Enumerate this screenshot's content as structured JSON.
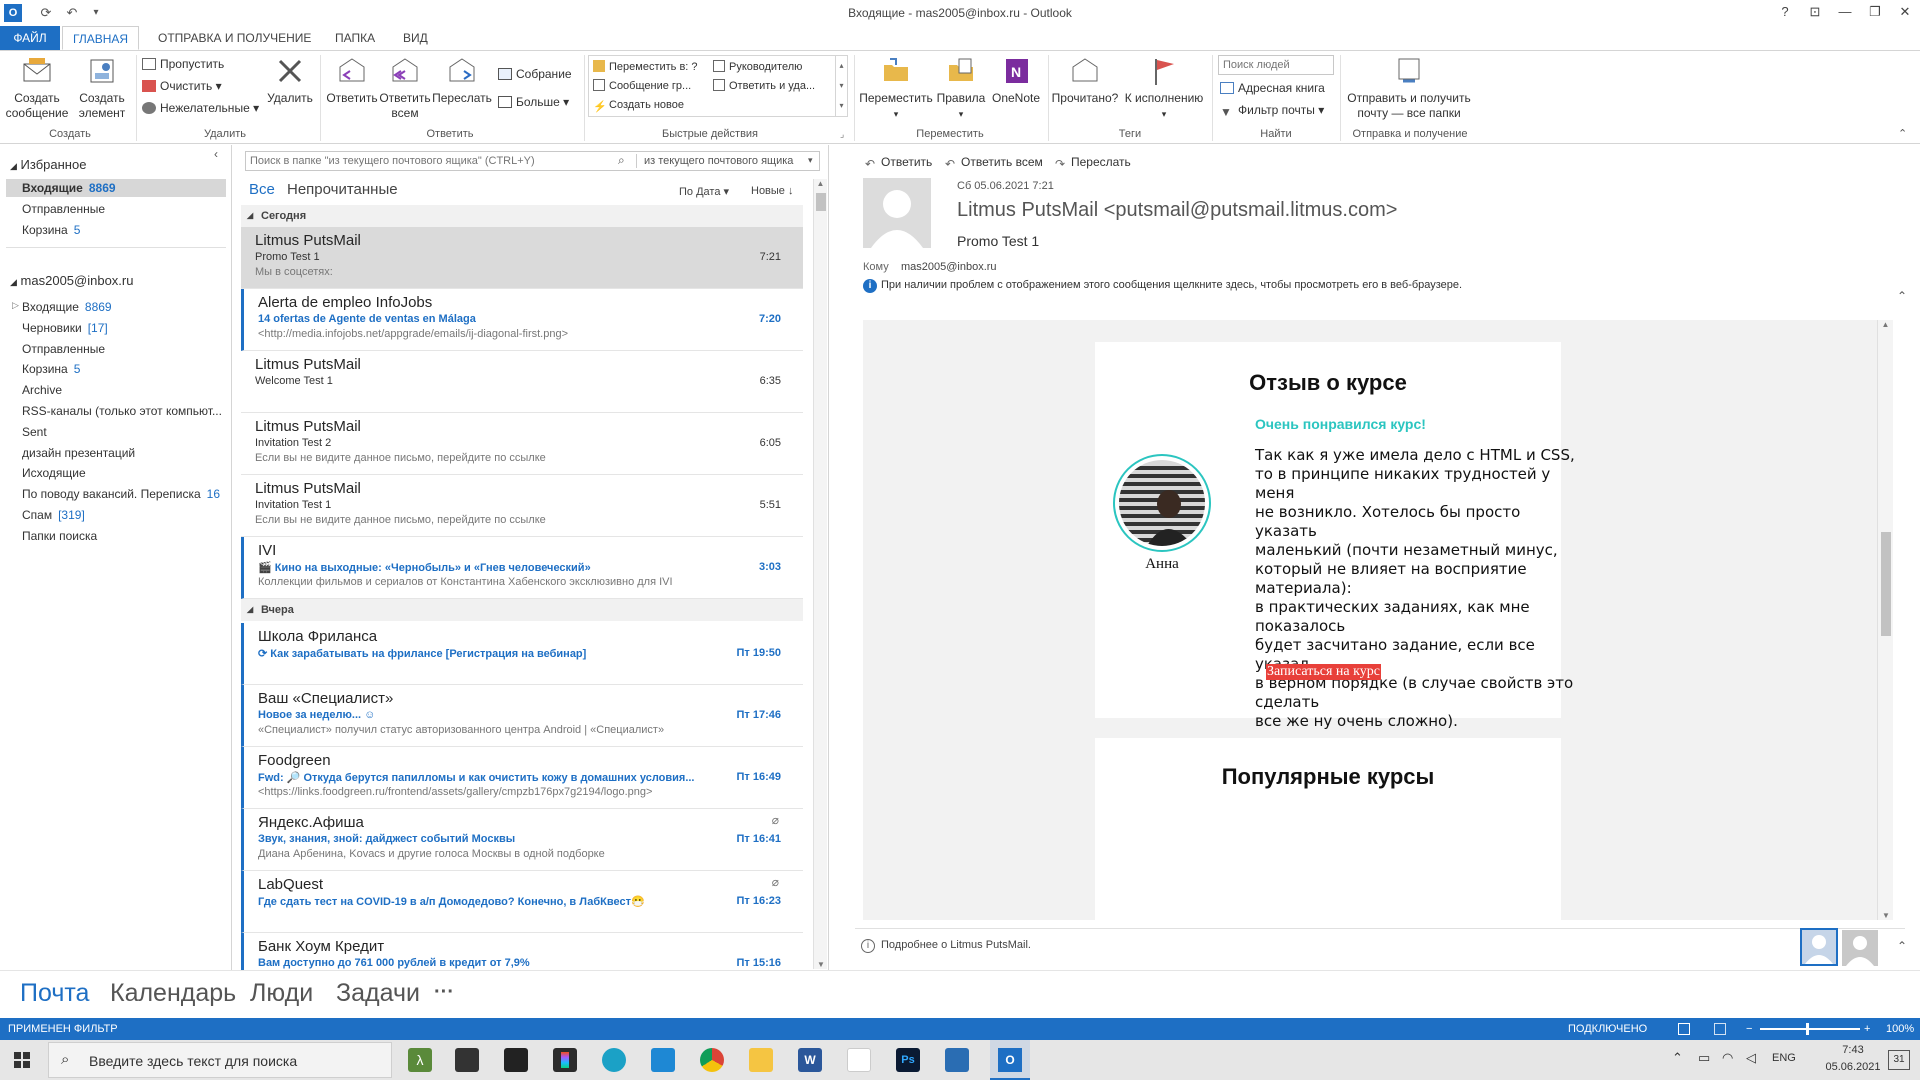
{
  "window": {
    "title": "Входящие - mas2005@inbox.ru - Outlook"
  },
  "titlebar": {
    "help": "?",
    "restore_ribbon": "⊡",
    "minimize": "—",
    "maximize": "❐",
    "close": "✕"
  },
  "tabs": [
    "ФАЙЛ",
    "ГЛАВНАЯ",
    "ОТПРАВКА И ПОЛУЧЕНИЕ",
    "ПАПКА",
    "ВИД"
  ],
  "ribbon": {
    "create": {
      "new_message": "Создать\nсообщение",
      "new_item": "Создать\nэлемент",
      "label": "Создать"
    },
    "delete": {
      "ignore": "Пропустить",
      "clean": "Очистить",
      "junk": "Нежелательные",
      "delete": "Удалить",
      "label": "Удалить"
    },
    "respond": {
      "reply": "Ответить",
      "reply_all": "Ответить\nвсем",
      "forward": "Переслать",
      "meeting": "Собрание",
      "more": "Больше",
      "label": "Ответить"
    },
    "quick_steps": {
      "move_to": "Переместить в: ?",
      "team_email": "Сообщение гр...",
      "create_new": "Создать новое",
      "to_manager": "Руководителю",
      "reply_delete": "Ответить и уда...",
      "label": "Быстрые действия"
    },
    "move": {
      "move": "Переместить",
      "rules": "Правила",
      "onenote": "OneNote",
      "label": "Переместить"
    },
    "tags": {
      "read": "Прочитано?",
      "followup": "К исполнению",
      "label": "Теги"
    },
    "find": {
      "search_people_placeholder": "Поиск людей",
      "address_book": "Адресная книга",
      "filter_email": "Фильтр почты",
      "label": "Найти"
    },
    "send_receive": {
      "send_all": "Отправить и получить\nпочту — все папки",
      "label": "Отправка и получение"
    }
  },
  "leftnav": {
    "favorites": "Избранное",
    "fav_items": [
      {
        "label": "Входящие",
        "count": "8869"
      },
      {
        "label": "Отправленные",
        "count": ""
      },
      {
        "label": "Корзина",
        "count": "5"
      }
    ],
    "account": "mas2005@inbox.ru",
    "folders": [
      {
        "label": "Входящие",
        "count": "8869"
      },
      {
        "label": "Черновики",
        "count": "[17]"
      },
      {
        "label": "Отправленные",
        "count": ""
      },
      {
        "label": "Корзина",
        "count": "5"
      },
      {
        "label": "Archive",
        "count": ""
      },
      {
        "label": "RSS-каналы (только этот компьют...",
        "count": ""
      },
      {
        "label": "Sent",
        "count": ""
      },
      {
        "label": "дизайн презентаций",
        "count": ""
      },
      {
        "label": "Исходящие",
        "count": ""
      },
      {
        "label": "По поводу вакансий. Переписка",
        "count": "16"
      },
      {
        "label": "Спам",
        "count": "[319]"
      },
      {
        "label": "Папки поиска",
        "count": ""
      }
    ]
  },
  "search": {
    "placeholder": "Поиск в папке \"из текущего почтового ящика\" (CTRL+Y)",
    "scope": "из текущего почтового ящика"
  },
  "list_filters": {
    "all": "Все",
    "unread": "Непрочитанные",
    "by_date": "По Дата",
    "newest": "Новые"
  },
  "groups": {
    "today": "Сегодня",
    "yesterday": "Вчера"
  },
  "messages": [
    {
      "from": "Litmus PutsMail",
      "subject": "Promo Test 1",
      "preview": "Мы в соцсетях:",
      "time": "7:21",
      "unread": false
    },
    {
      "from": "Alerta de empleo InfoJobs",
      "subject": "14 ofertas de Agente de ventas en Málaga",
      "preview": "<http://media.infojobs.net/appgrade/emails/ij-diagonal-first.png>",
      "time": "7:20",
      "unread": true
    },
    {
      "from": "Litmus PutsMail",
      "subject": "Welcome Test 1",
      "preview": "",
      "time": "6:35",
      "unread": false
    },
    {
      "from": "Litmus PutsMail",
      "subject": "Invitation Test 2",
      "preview": "Если вы не видите данное письмо, перейдите по ссылке",
      "time": "6:05",
      "unread": false
    },
    {
      "from": "Litmus PutsMail",
      "subject": "Invitation Test 1",
      "preview": "Если вы не видите данное письмо, перейдите по ссылке",
      "time": "5:51",
      "unread": false
    },
    {
      "from": "IVI",
      "subject": "🎬 Кино на выходные: «Чернобыль» и «Гнев человеческий»",
      "preview": "Коллекции фильмов и сериалов от Константина Хабенского эксклюзивно для IVI",
      "time": "3:03",
      "unread": true
    },
    {
      "from": "Школа Фриланса",
      "subject": "⟳ Как зарабатывать на фрилансе [Регистрация на вебинар]",
      "preview": "",
      "time": "Пт 19:50",
      "unread": true
    },
    {
      "from": "Ваш «Специалист»",
      "subject": "Новое за неделю... ☺",
      "preview": "«Специалист» получил статус авторизованного центра Android | «Специалист»",
      "time": "Пт 17:46",
      "unread": true
    },
    {
      "from": "Foodgreen",
      "subject": "Fwd: 🔎 Откуда берутся папилломы и как очистить кожу в домашних условия...",
      "preview": "<https://links.foodgreen.ru/frontend/assets/gallery/cmpzb176px7g2194/logo.png>",
      "time": "Пт 16:49",
      "unread": true
    },
    {
      "from": "Яндекс.Афиша",
      "subject": "Звук, знания, зной: дайджест событий Москвы",
      "preview": "Диана Арбенина, Kovacs и другие голоса Москвы в одной подборке",
      "time": "Пт 16:41",
      "unread": true
    },
    {
      "from": "LabQuest",
      "subject": "Где сдать тест на COVID-19 в а/п Домодедово? Конечно, в ЛабКвест😷",
      "preview": "",
      "time": "Пт 16:23",
      "unread": true
    },
    {
      "from": "Банк Хоум Кредит",
      "subject": "Вам доступно до 761 000 рублей в кредит от 7,9%",
      "preview": "",
      "time": "Пт 15:16",
      "unread": true
    }
  ],
  "reading": {
    "actions": {
      "reply": "Ответить",
      "reply_all": "Ответить всем",
      "forward": "Переслать"
    },
    "date": "Сб 05.06.2021 7:21",
    "sender": "Litmus PutsMail <putsmail@putsmail.litmus.com>",
    "subject": "Promo Test 1",
    "to_label": "Кому",
    "to": "mas2005@inbox.ru",
    "info": "При наличии проблем с отображением этого сообщения щелкните здесь, чтобы просмотреть его в веб-браузере.",
    "footer": "Подробнее о Litmus PutsMail."
  },
  "email": {
    "title": "Отзыв о курсе",
    "highlight": "Очень понравился курс!",
    "body_lines": [
      "Так как я уже имела дело с HTML и CSS,",
      "то в принципе никаких трудностей у меня",
      "не возникло. Хотелось бы просто указать",
      "маленький (почти незаметный минус,",
      "который не влияет на восприятие материала):",
      "в практических заданиях, как мне показалось",
      "будет засчитано задание, если все указал",
      "в верном порядке (в случае свойств это сделать",
      "все же ну очень сложно)."
    ],
    "author": "Анна",
    "cta": "Записаться на курс",
    "popular": "Популярные курсы",
    "accent_color": "#2bc5c0",
    "cta_color": "#e8403a"
  },
  "bottomnav": {
    "mail": "Почта",
    "calendar": "Календарь",
    "people": "Люди",
    "tasks": "Задачи",
    "more": "···"
  },
  "statusbar": {
    "left": "ПРИМЕНЕН ФИЛЬТР",
    "connected": "ПОДКЛЮЧЕНО",
    "zoom": "100%"
  },
  "taskbar": {
    "search_placeholder": "Введите здесь текст для поиска",
    "lang": "ENG",
    "time": "7:43",
    "date": "05.06.2021",
    "notif": "31"
  }
}
